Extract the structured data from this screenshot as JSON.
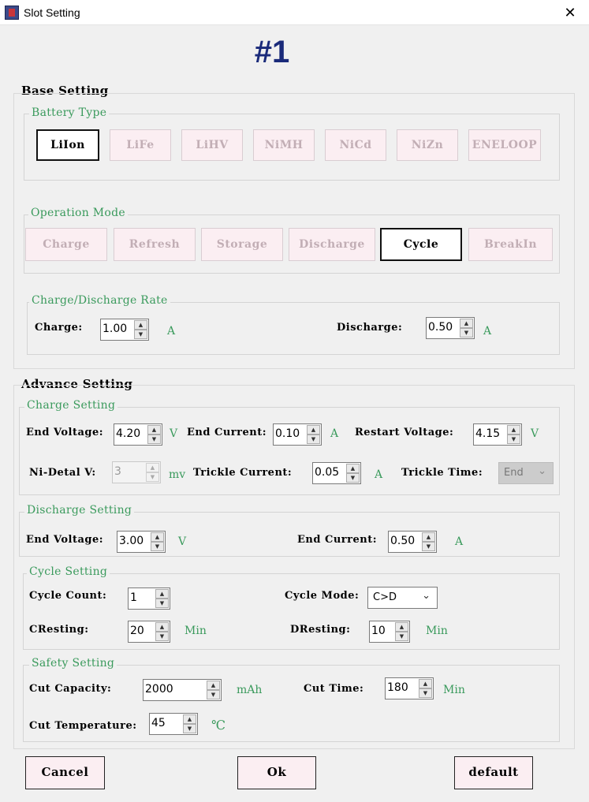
{
  "window": {
    "title": "Slot Setting",
    "close_glyph": "✕"
  },
  "slot_label": "#1",
  "base": {
    "title": "Base Setting",
    "battery_type": {
      "legend": "Battery Type",
      "options": [
        "LiIon",
        "LiFe",
        "LiHV",
        "NiMH",
        "NiCd",
        "NiZn",
        "ENELOOP"
      ],
      "selected": "LiIon"
    },
    "operation_mode": {
      "legend": "Operation Mode",
      "options": [
        "Charge",
        "Refresh",
        "Storage",
        "Discharge",
        "Cycle",
        "BreakIn"
      ],
      "selected": "Cycle"
    },
    "rate": {
      "legend": "Charge/Discharge Rate",
      "charge_label": "Charge:",
      "charge_value": "1.00",
      "charge_unit": "A",
      "discharge_label": "Discharge:",
      "discharge_value": "0.50",
      "discharge_unit": "A"
    }
  },
  "advance": {
    "title": "Advance Setting",
    "charge": {
      "legend": "Charge Setting",
      "end_voltage_label": "End Voltage:",
      "end_voltage": "4.20",
      "end_voltage_unit": "V",
      "end_current_label": "End Current:",
      "end_current": "0.10",
      "end_current_unit": "A",
      "restart_voltage_label": "Restart Voltage:",
      "restart_voltage": "4.15",
      "restart_voltage_unit": "V",
      "ni_detal_label": "Ni-Detal V:",
      "ni_detal": "3",
      "ni_detal_unit": "mv",
      "trickle_current_label": "Trickle Current:",
      "trickle_current": "0.05",
      "trickle_current_unit": "A",
      "trickle_time_label": "Trickle Time:",
      "trickle_time": "End"
    },
    "discharge": {
      "legend": "Discharge Setting",
      "end_voltage_label": "End Voltage:",
      "end_voltage": "3.00",
      "end_voltage_unit": "V",
      "end_current_label": "End Current:",
      "end_current": "0.50",
      "end_current_unit": "A"
    },
    "cycle": {
      "legend": "Cycle Setting",
      "count_label": "Cycle Count:",
      "count": "1",
      "mode_label": "Cycle Mode:",
      "mode": "C>D",
      "cresting_label": "CResting:",
      "cresting": "20",
      "cresting_unit": "Min",
      "dresting_label": "DResting:",
      "dresting": "10",
      "dresting_unit": "Min"
    },
    "safety": {
      "legend": "Safety Setting",
      "cut_capacity_label": "Cut Capacity:",
      "cut_capacity": "2000",
      "cut_capacity_unit": "mAh",
      "cut_time_label": "Cut Time:",
      "cut_time": "180",
      "cut_time_unit": "Min",
      "cut_temp_label": "Cut Temperature:",
      "cut_temp": "45",
      "cut_temp_unit": "℃"
    }
  },
  "buttons": {
    "cancel": "Cancel",
    "ok": "Ok",
    "default": "default"
  },
  "colors": {
    "legend_green": "#3a9a5c",
    "title_blue": "#1a2a7a",
    "button_pink": "#fbeef2"
  }
}
